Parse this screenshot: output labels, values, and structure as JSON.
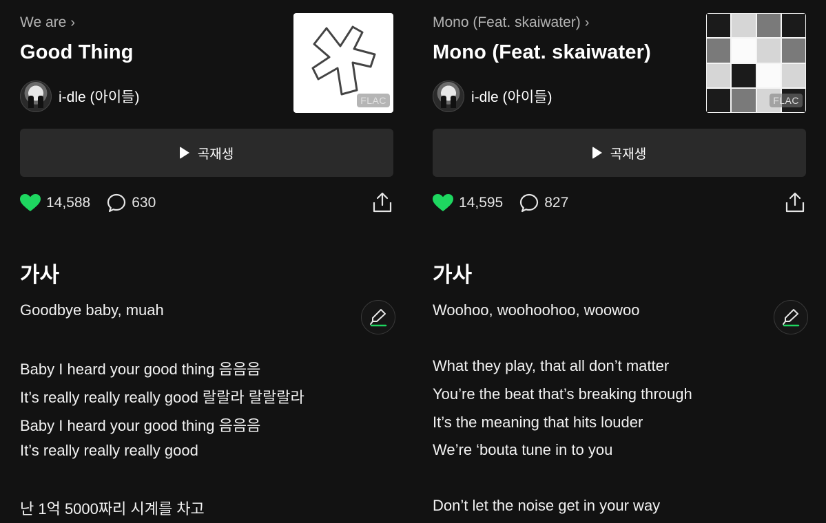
{
  "colors": {
    "background": "#121212",
    "accent": "#1ed760",
    "button_bg": "#2a2a2a",
    "muted_text": "#b3b3b3"
  },
  "songs": [
    {
      "album": "We are",
      "title": "Good Thing",
      "artist": "i-dle (아이들)",
      "quality_badge": "FLAC",
      "play_label": "곡재생",
      "likes": "14,588",
      "comments": "630",
      "lyrics_heading": "가사",
      "lyrics_first": "Goodbye baby, muah",
      "lyrics": [
        "Baby I heard your good thing 음음음",
        "It’s really really really good 랄랄라 랄랄랄라",
        "Baby I heard your good thing 음음음",
        "It’s really really really good",
        "난 1억 5000짜리 시계를 차고"
      ]
    },
    {
      "album": "Mono (Feat. skaiwater)",
      "title": "Mono (Feat. skaiwater)",
      "artist": "i-dle (아이들)",
      "quality_badge": "FLAC",
      "play_label": "곡재생",
      "likes": "14,595",
      "comments": "827",
      "lyrics_heading": "가사",
      "lyrics_first": "Woohoo, woohoohoo, woowoo",
      "lyrics": [
        "What they play, that all don’t matter",
        "You’re the beat that’s breaking through",
        "It’s the meaning that hits louder",
        "We’re ‘bouta tune in to you",
        "Don’t let the noise get in your way"
      ]
    }
  ],
  "icons": {
    "play": "play-icon",
    "like": "heart-icon",
    "comment": "comment-icon",
    "share": "share-icon",
    "lyric_edit": "highlighter-icon",
    "album_chevron": "chevron-right-icon"
  }
}
